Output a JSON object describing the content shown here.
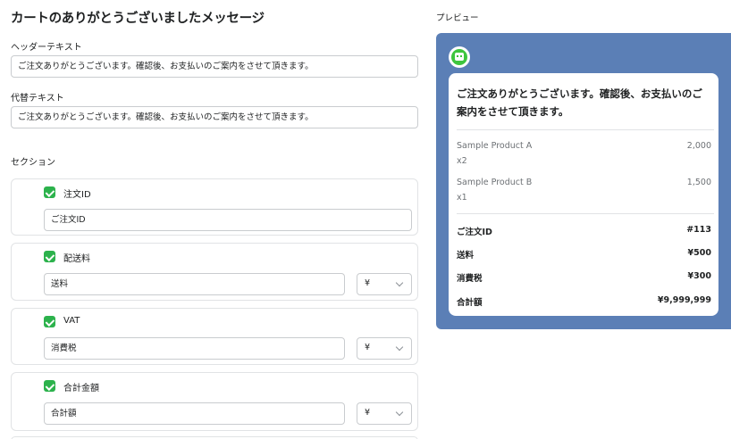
{
  "page": {
    "title": "カートのありがとうございましたメッセージ",
    "header_text_label": "ヘッダーテキスト",
    "header_text_value": "ご注文ありがとうございます。確認後、お支払いのご案内をさせて頂きます。",
    "alt_text_label": "代替テキスト",
    "alt_text_value": "ご注文ありがとうございます。確認後、お支払いのご案内をさせて頂きます。",
    "sections_label": "セクション"
  },
  "sections": [
    {
      "title": "注文ID",
      "input_value": "ご注文ID",
      "checked": true
    },
    {
      "title": "配送料",
      "input_value": "送料",
      "currency": "¥",
      "checked": true
    },
    {
      "title": "VAT",
      "input_value": "消費税",
      "currency": "¥",
      "checked": true
    },
    {
      "title": "合計金額",
      "input_value": "合計額",
      "currency": "¥",
      "checked": true
    }
  ],
  "preview": {
    "label": "プレビュー",
    "background_color": "#5b7fb6",
    "header_text": "ご注文ありがとうございます。確認後、お支払いのご案内をさせて頂きます。",
    "products": [
      {
        "name": "Sample Product A",
        "qty": "x2",
        "price": "2,000"
      },
      {
        "name": "Sample Product B",
        "qty": "x1",
        "price": "1,500"
      }
    ],
    "summary": [
      {
        "label": "ご注文ID",
        "value": "#113"
      },
      {
        "label": "送料",
        "value": "¥500"
      },
      {
        "label": "消費税",
        "value": "¥300"
      },
      {
        "label": "合計額",
        "value": "¥9,999,999"
      }
    ]
  },
  "colors": {
    "accent_green": "#2cb24c",
    "preview_bg": "#5b7fb6"
  }
}
